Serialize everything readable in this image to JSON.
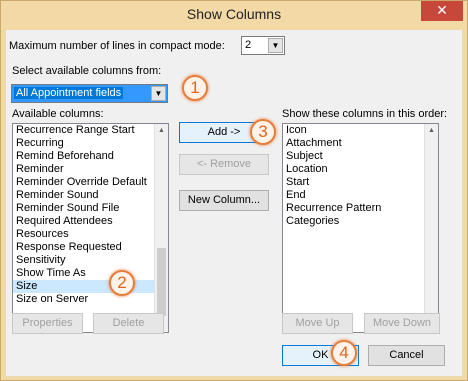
{
  "window": {
    "title": "Show Columns",
    "close_glyph": "✕"
  },
  "max_lines": {
    "label": "Maximum number of lines in compact mode:",
    "value": "2"
  },
  "select_from": {
    "label": "Select available columns from:",
    "value": "All Appointment fields"
  },
  "available": {
    "label": "Available columns:",
    "items": [
      "Recurrence Range Start",
      "Recurring",
      "Remind Beforehand",
      "Reminder",
      "Reminder Override Default",
      "Reminder Sound",
      "Reminder Sound File",
      "Required Attendees",
      "Resources",
      "Response Requested",
      "Sensitivity",
      "Show Time As",
      "Size",
      "Size on Server"
    ],
    "selected_index": 12
  },
  "shown": {
    "label": "Show these columns in this order:",
    "items": [
      "Icon",
      "Attachment",
      "Subject",
      "Location",
      "Start",
      "End",
      "Recurrence Pattern",
      "Categories"
    ]
  },
  "buttons": {
    "add": "Add ->",
    "remove": "<- Remove",
    "new_column": "New Column...",
    "properties": "Properties",
    "delete": "Delete",
    "move_up": "Move Up",
    "move_down": "Move Down",
    "ok": "OK",
    "cancel": "Cancel"
  },
  "markers": [
    "1",
    "2",
    "3",
    "4"
  ],
  "icons": {
    "dropdown": "chevron-down-icon",
    "scroll_up": "scroll-up-icon",
    "scroll_down": "scroll-down-icon"
  },
  "colors": {
    "frame": "#f3d9a6",
    "close": "#c7473a",
    "marker": "#e67e3c"
  }
}
